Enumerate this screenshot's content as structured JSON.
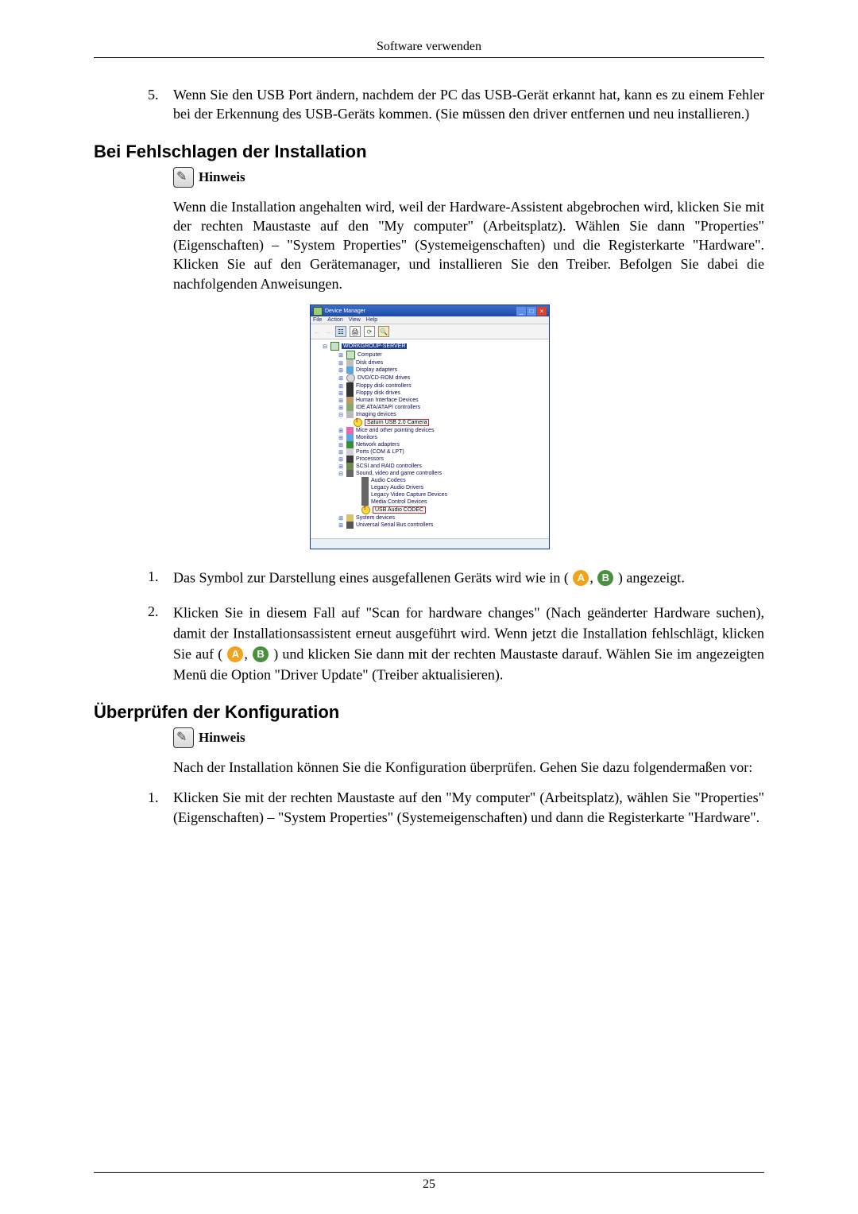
{
  "running_head": "Software verwenden",
  "page_number": "25",
  "item5": {
    "num": "5.",
    "text": "Wenn Sie den USB Port ändern, nachdem der PC das USB-Gerät erkannt hat, kann es zu einem Fehler bei der Erkennung des USB-Geräts kommen. (Sie müssen den driver entfernen und neu installieren.)"
  },
  "sec1_heading": "Bei Fehlschlagen der Installation",
  "note_label": "Hinweis",
  "sec1_para": "Wenn die Installation angehalten wird, weil der Hardware-Assistent abgebrochen wird, klicken Sie mit der rechten Maustaste auf den \"My computer\" (Arbeitsplatz). Wählen Sie dann \"Properties\" (Eigenschaften) – \"System Properties\" (Systemeigenschaften) und die Registerkarte \"Hardware\". Klicken Sie auf den Gerätemanager, und installieren Sie den Treiber. Befolgen Sie dabei die nachfolgenden Anweisungen.",
  "device_manager": {
    "title": "Device Manager",
    "menu": [
      "File",
      "Action",
      "View",
      "Help"
    ],
    "root": "WORKGROUP-SERVER",
    "nodes": [
      {
        "icon": "ico-pc",
        "label": "Computer"
      },
      {
        "icon": "ico-disk",
        "label": "Disk drives"
      },
      {
        "icon": "ico-monitor",
        "label": "Display adapters"
      },
      {
        "icon": "ico-cd",
        "label": "DVD/CD-ROM drives"
      },
      {
        "icon": "ico-floppy",
        "label": "Floppy disk controllers"
      },
      {
        "icon": "ico-floppy",
        "label": "Floppy disk drives"
      },
      {
        "icon": "ico-hid",
        "label": "Human Interface Devices"
      },
      {
        "icon": "ico-ide",
        "label": "IDE ATA/ATAPI controllers"
      }
    ],
    "imaging": {
      "label": "Imaging devices",
      "child_warn": "Saturn USB 2.0 Camera"
    },
    "after_imaging": [
      {
        "icon": "ico-mouse",
        "label": "Mice and other pointing devices"
      },
      {
        "icon": "ico-monitor",
        "label": "Monitors"
      },
      {
        "icon": "ico-net",
        "label": "Network adapters"
      },
      {
        "icon": "ico-port",
        "label": "Ports (COM & LPT)"
      },
      {
        "icon": "ico-cpu",
        "label": "Processors"
      },
      {
        "icon": "ico-scsi",
        "label": "SCSI and RAID controllers"
      }
    ],
    "sound": {
      "label": "Sound, video and game controllers",
      "children": [
        "Audio Codecs",
        "Legacy Audio Drivers",
        "Legacy Video Capture Devices",
        "Media Control Devices"
      ],
      "child_warn": "USB Audio CODEC"
    },
    "tail": [
      {
        "icon": "ico-sys",
        "label": "System devices"
      },
      {
        "icon": "ico-usb",
        "label": "Universal Serial Bus controllers"
      }
    ]
  },
  "badge_a": "A",
  "badge_b": "B",
  "list_below": {
    "i1_num": "1.",
    "i1_pre": "Das Symbol zur Darstellung eines ausgefallenen Geräts wird wie in (",
    "i1_post": ") angezeigt.",
    "i2_num": "2.",
    "i2_a": "Klicken Sie in diesem Fall auf \"Scan for hardware changes\" (Nach geänderter Hardware suchen), damit der Installationsassistent erneut ausgeführt wird. Wenn jetzt die Installation fehlschlägt, klicken Sie auf (",
    "i2_b": ") und klicken Sie dann mit der rechten Maustaste darauf. Wählen Sie im angezeigten Menü die Option \"Driver Update\" (Treiber aktualisieren)."
  },
  "sec2_heading": "Überprüfen der Konfiguration",
  "sec2_para": "Nach der Installation können Sie die Konfiguration überprüfen. Gehen Sie dazu folgendermaßen vor:",
  "sec2_item1_num": "1.",
  "sec2_item1_text": "Klicken Sie mit der rechten Maustaste auf den \"My computer\" (Arbeitsplatz), wählen Sie \"Properties\" (Eigenschaften) – \"System Properties\" (Systemeigenschaften) und dann die Registerkarte \"Hardware\"."
}
